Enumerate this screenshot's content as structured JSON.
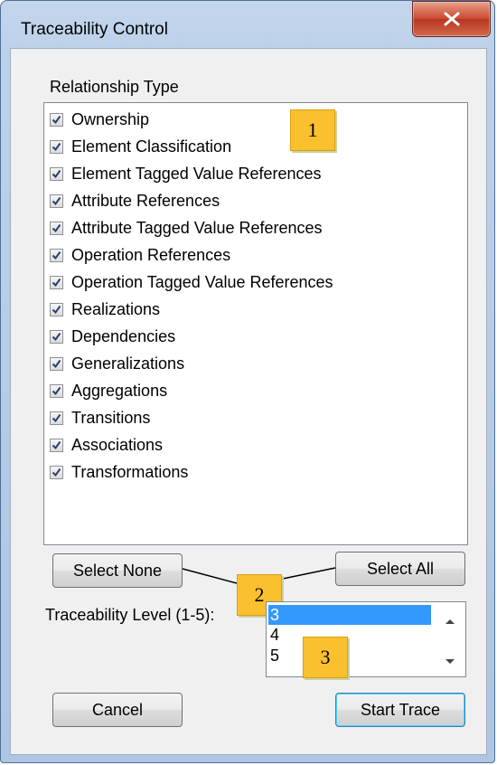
{
  "window": {
    "title": "Traceability Control"
  },
  "relationship": {
    "label": "Relationship Type",
    "items": [
      {
        "label": "Ownership",
        "checked": true
      },
      {
        "label": "Element Classification",
        "checked": true
      },
      {
        "label": "Element Tagged Value References",
        "checked": true
      },
      {
        "label": "Attribute References",
        "checked": true
      },
      {
        "label": "Attribute Tagged Value References",
        "checked": true
      },
      {
        "label": "Operation References",
        "checked": true
      },
      {
        "label": "Operation Tagged Value References",
        "checked": true
      },
      {
        "label": "Realizations",
        "checked": true
      },
      {
        "label": "Dependencies",
        "checked": true
      },
      {
        "label": "Generalizations",
        "checked": true
      },
      {
        "label": "Aggregations",
        "checked": true
      },
      {
        "label": "Transitions",
        "checked": true
      },
      {
        "label": "Associations",
        "checked": true
      },
      {
        "label": "Transformations",
        "checked": true
      }
    ]
  },
  "buttons": {
    "select_none": "Select None",
    "select_all": "Select All",
    "cancel": "Cancel",
    "start_trace": "Start Trace"
  },
  "level": {
    "label": "Traceability Level (1-5):",
    "options": [
      "3",
      "4",
      "5"
    ],
    "selected": "3"
  },
  "callouts": [
    "1",
    "2",
    "3"
  ],
  "colors": {
    "callout": "#fbc02d",
    "selection": "#3399ff",
    "close_button": "#c9482f"
  }
}
